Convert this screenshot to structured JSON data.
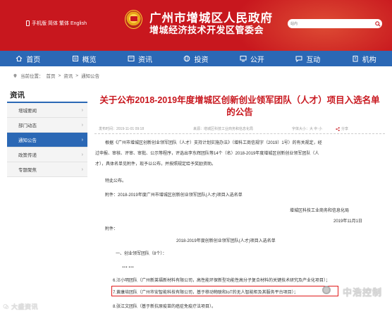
{
  "header": {
    "util_links": [
      "手机版",
      "简体",
      "繁体",
      "English"
    ],
    "title_line1": "广州市增城区人民政府",
    "title_line2": "增城经济技术开发区管委会",
    "search_label": "站内",
    "search_placeholder": "",
    "brand_color": "#c8171e"
  },
  "nav": {
    "items": [
      {
        "label": "首页",
        "icon": "home-icon"
      },
      {
        "label": "概览",
        "icon": "book-icon"
      },
      {
        "label": "资讯",
        "icon": "news-icon"
      },
      {
        "label": "投资",
        "icon": "globe-icon"
      },
      {
        "label": "公开",
        "icon": "screen-icon"
      },
      {
        "label": "互动",
        "icon": "chat-icon"
      },
      {
        "label": "机构",
        "icon": "building-icon"
      }
    ],
    "color": "#2b68b5"
  },
  "breadcrumb": {
    "prefix": "当前位置：",
    "items": [
      "首页",
      "资讯",
      "通知公告"
    ],
    "sep": ">"
  },
  "sidebar": {
    "heading": "资讯",
    "items": [
      {
        "label": "增城要闻",
        "active": false
      },
      {
        "label": "部门动态",
        "active": false
      },
      {
        "label": "通知公告",
        "active": true
      },
      {
        "label": "政策传递",
        "active": false
      },
      {
        "label": "专题聚焦",
        "active": false
      }
    ]
  },
  "article": {
    "title": "关于公布2018-2019年度增城区创新创业领军团队（人才）项目入选名单的公告",
    "date": "发布时间：2019-11-01 09:18",
    "source": "来源：增城区科技工业商务和信息化局",
    "font_size": "字体大小：大 中 小",
    "share": "分享",
    "p1": "根据《广州市增城区创新创业领军团队（人才）支持计划实施办法》（增科工商信规字（2019）1号）的有关规定，经",
    "p2": "过申报、审核、评审、审批、公示等程序，评选出李东辉团队等14个（名）2018-2019年度增城区创新创业领军团队（人",
    "p3": "才），具体名单见附件，现予以公布，并按照规定给予奖励资助。",
    "p4": "特此公布。",
    "attach1": "附件：2018-2019年度广州市增城区创新创业领军团队(人才)项目入选名单",
    "signature": "增城区科技工业商务和信息化局",
    "sign_date": "2019年11月1日",
    "attach_label": "附件：",
    "list_title": "2018-2019年度创新创业领军团队(人才)项目入选名单",
    "section": "一、创业领军团队（8个）：",
    "dots": "……",
    "item6": "6.汪小明团队（广州新莱福新材料有限公司，高性能环保新型功能性高分子复合材料的关键技术研究及产业化项目）；",
    "item7": "7.黄康培团队（广州市安智能科技有限公司，基于移动物联和IoT的无人智能柜及其服务平台项目）；",
    "item8": "8.张江文团队（基于新抗原疫苗的癌症免疫疗法项目）。"
  },
  "watermark": {
    "right_text": "中浩控制",
    "left_text": "大盛资讯"
  }
}
